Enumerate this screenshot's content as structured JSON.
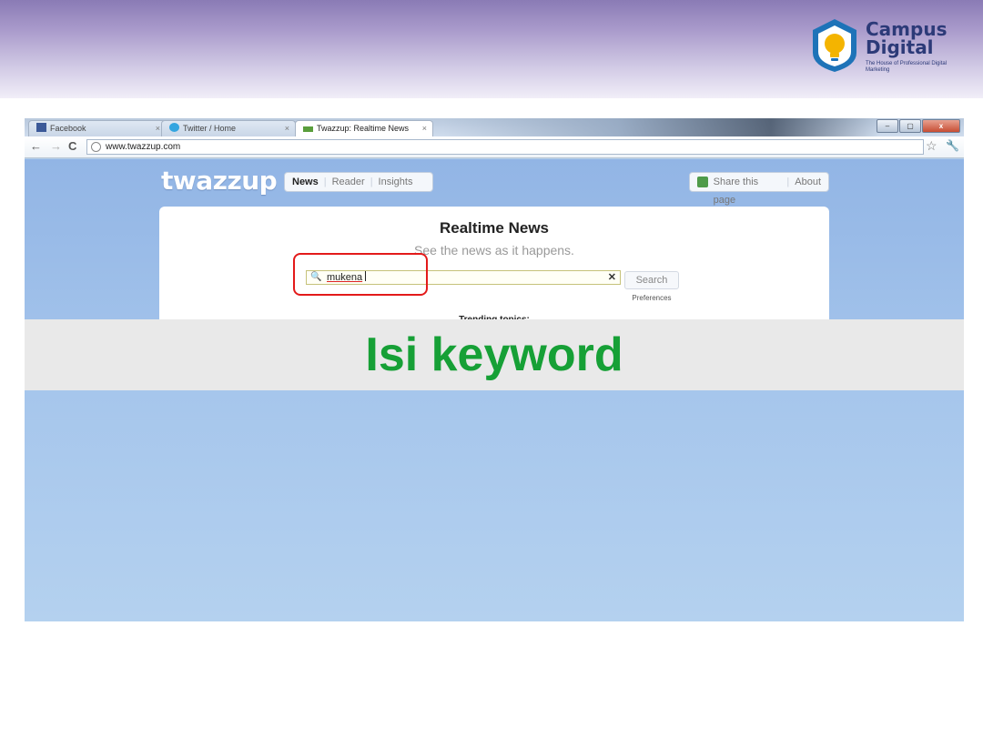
{
  "brand": {
    "name_line1": "Campus",
    "name_line2": "Digital",
    "tagline": "The House of Professional Digital Marketing",
    "colors": {
      "text": "#2c3a78",
      "shield_outer": "#1e73b8",
      "shield_inner": "#f4b400"
    },
    "icon": "lightbulb-shield-icon"
  },
  "browser": {
    "tabs": [
      {
        "label": "Facebook",
        "icon": "facebook-icon",
        "active": false
      },
      {
        "label": "Twitter / Home",
        "icon": "twitter-bird-icon",
        "active": false
      },
      {
        "label": "Twazzup: Realtime News",
        "icon": "twazzup-icon",
        "active": true
      }
    ],
    "window_controls": {
      "minimize": "–",
      "maximize": "▢",
      "close": "x"
    },
    "nav": {
      "back": "←",
      "forward": "→",
      "reload": "C"
    },
    "address": "www.twazzup.com"
  },
  "site": {
    "logo": "twazzup",
    "nav_items": [
      "News",
      "Reader",
      "Insights"
    ],
    "right_items": [
      "Share this page",
      "About"
    ],
    "heading": "Realtime News",
    "subheading": "See the news as it happens.",
    "search": {
      "value": "mukena",
      "button": "Search",
      "preferences": "Preferences"
    },
    "trending_label": "Trending topics:"
  },
  "slide": {
    "caption": "Isi keyword",
    "caption_color": "#16a036",
    "highlight_color": "#e31a1a"
  }
}
